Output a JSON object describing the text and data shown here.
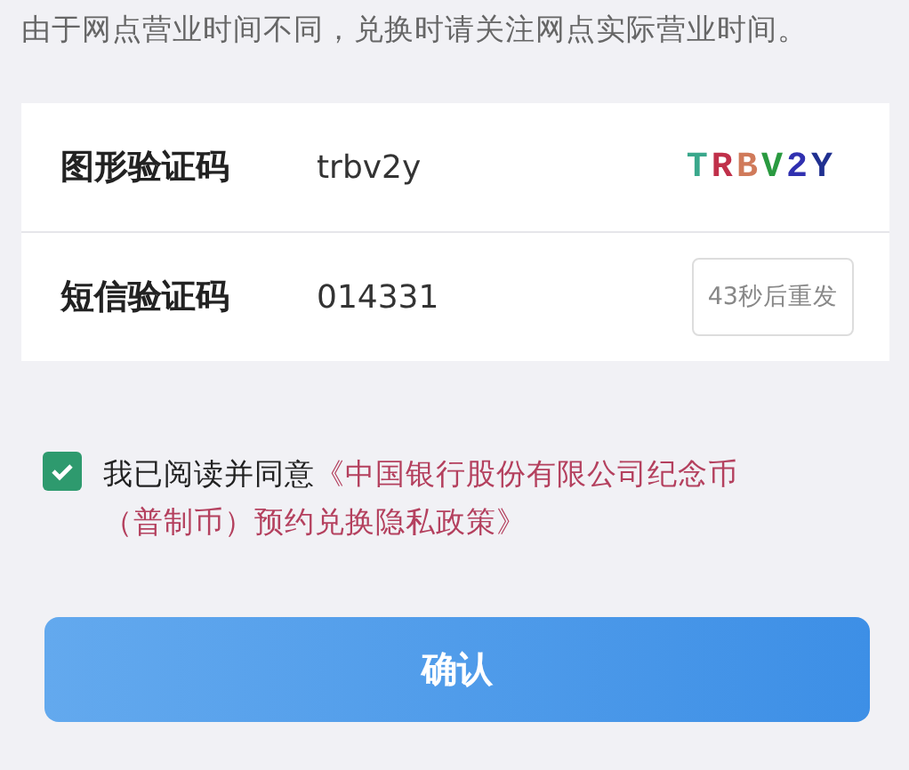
{
  "notice": "由于网点营业时间不同，兑换时请关注网点实际营业时间。",
  "form": {
    "rows": [
      {
        "kind": "captcha",
        "label": "图形验证码",
        "value": "trbv2y",
        "captcha": "TRBV2Y"
      },
      {
        "kind": "sms",
        "label": "短信验证码",
        "value": "014331",
        "action": "43秒后重发"
      }
    ]
  },
  "agreement": {
    "checked": true,
    "text": "我已阅读并同意",
    "link_lines": [
      "《中国银行股份有限公司纪念币",
      "（普制币）预约兑换隐私政策》"
    ]
  },
  "confirm_button": "确认"
}
